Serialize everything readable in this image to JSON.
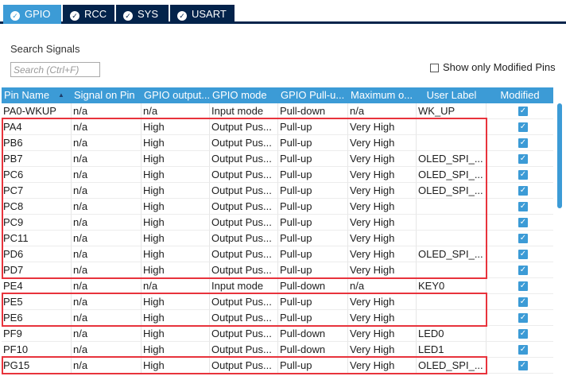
{
  "tabs": [
    {
      "label": "GPIO",
      "active": true
    },
    {
      "label": "RCC",
      "active": false
    },
    {
      "label": "SYS",
      "active": false
    },
    {
      "label": "USART",
      "active": false
    }
  ],
  "search": {
    "title": "Search Signals",
    "placeholder": "Search (Ctrl+F)",
    "value": "",
    "show_modified_label": "Show only Modified Pins",
    "show_modified_checked": false
  },
  "table": {
    "headers": [
      "Pin Name",
      "Signal on Pin",
      "GPIO output...",
      "GPIO mode",
      "GPIO Pull-u...",
      "Maximum o...",
      "User Label",
      "Modified"
    ],
    "sort_indicator": "▲",
    "rows": [
      {
        "pin": "PA0-WKUP",
        "signal": "n/a",
        "output": "n/a",
        "mode": "Input mode",
        "pull": "Pull-down",
        "speed": "n/a",
        "label": "WK_UP",
        "modified": true
      },
      {
        "pin": "PA4",
        "signal": "n/a",
        "output": "High",
        "mode": "Output Pus...",
        "pull": "Pull-up",
        "speed": "Very High",
        "label": "",
        "modified": true
      },
      {
        "pin": "PB6",
        "signal": "n/a",
        "output": "High",
        "mode": "Output Pus...",
        "pull": "Pull-up",
        "speed": "Very High",
        "label": "",
        "modified": true
      },
      {
        "pin": "PB7",
        "signal": "n/a",
        "output": "High",
        "mode": "Output Pus...",
        "pull": "Pull-up",
        "speed": "Very High",
        "label": "OLED_SPI_...",
        "modified": true
      },
      {
        "pin": "PC6",
        "signal": "n/a",
        "output": "High",
        "mode": "Output Pus...",
        "pull": "Pull-up",
        "speed": "Very High",
        "label": "OLED_SPI_...",
        "modified": true
      },
      {
        "pin": "PC7",
        "signal": "n/a",
        "output": "High",
        "mode": "Output Pus...",
        "pull": "Pull-up",
        "speed": "Very High",
        "label": "OLED_SPI_...",
        "modified": true
      },
      {
        "pin": "PC8",
        "signal": "n/a",
        "output": "High",
        "mode": "Output Pus...",
        "pull": "Pull-up",
        "speed": "Very High",
        "label": "",
        "modified": true
      },
      {
        "pin": "PC9",
        "signal": "n/a",
        "output": "High",
        "mode": "Output Pus...",
        "pull": "Pull-up",
        "speed": "Very High",
        "label": "",
        "modified": true
      },
      {
        "pin": "PC11",
        "signal": "n/a",
        "output": "High",
        "mode": "Output Pus...",
        "pull": "Pull-up",
        "speed": "Very High",
        "label": "",
        "modified": true
      },
      {
        "pin": "PD6",
        "signal": "n/a",
        "output": "High",
        "mode": "Output Pus...",
        "pull": "Pull-up",
        "speed": "Very High",
        "label": "OLED_SPI_...",
        "modified": true
      },
      {
        "pin": "PD7",
        "signal": "n/a",
        "output": "High",
        "mode": "Output Pus...",
        "pull": "Pull-up",
        "speed": "Very High",
        "label": "",
        "modified": true
      },
      {
        "pin": "PE4",
        "signal": "n/a",
        "output": "n/a",
        "mode": "Input mode",
        "pull": "Pull-down",
        "speed": "n/a",
        "label": "KEY0",
        "modified": true
      },
      {
        "pin": "PE5",
        "signal": "n/a",
        "output": "High",
        "mode": "Output Pus...",
        "pull": "Pull-up",
        "speed": "Very High",
        "label": "",
        "modified": true
      },
      {
        "pin": "PE6",
        "signal": "n/a",
        "output": "High",
        "mode": "Output Pus...",
        "pull": "Pull-up",
        "speed": "Very High",
        "label": "",
        "modified": true
      },
      {
        "pin": "PF9",
        "signal": "n/a",
        "output": "High",
        "mode": "Output Pus...",
        "pull": "Pull-down",
        "speed": "Very High",
        "label": "LED0",
        "modified": true
      },
      {
        "pin": "PF10",
        "signal": "n/a",
        "output": "High",
        "mode": "Output Pus...",
        "pull": "Pull-down",
        "speed": "Very High",
        "label": "LED1",
        "modified": true
      },
      {
        "pin": "PG15",
        "signal": "n/a",
        "output": "High",
        "mode": "Output Pus...",
        "pull": "Pull-up",
        "speed": "Very High",
        "label": "OLED_SPI_...",
        "modified": true
      }
    ]
  },
  "highlight_groups": [
    {
      "first_row": 1,
      "last_row": 10
    },
    {
      "first_row": 12,
      "last_row": 13
    },
    {
      "first_row": 16,
      "last_row": 16
    }
  ],
  "colors": {
    "tab_dark": "#03234b",
    "accent": "#3c9bd6",
    "highlight": "#e8333c"
  },
  "icons": {
    "tab_icon": "check-circle-icon",
    "sort_icon": "sort-ascending-icon",
    "modified_icon": "checkbox-checked-icon"
  }
}
